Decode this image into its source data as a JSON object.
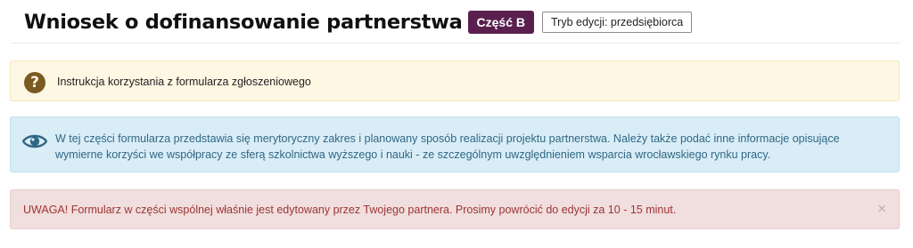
{
  "header": {
    "title": "Wniosek o dofinansowanie partnerstwa",
    "part_badge": "Część B",
    "mode_badge": "Tryb edycji: przedsiębiorca"
  },
  "alerts": {
    "instructions": {
      "icon": "question-circle-icon",
      "text": "Instrukcja korzystania z formularza zgłoszeniowego"
    },
    "info": {
      "icon": "eye-icon",
      "line1": "W tej części formularza przedstawia się merytoryczny zakres i planowany sposób realizacji projektu partnerstwa. Należy także podać inne informacje opisujące",
      "line2": "wymierne korzyści we współpracy ze sferą szkolnictwa wyższego i nauki - ze szczególnym uwzględnieniem wsparcia wrocławskiego rynku pracy."
    },
    "warning": {
      "text": "UWAGA! Formularz w części wspólnej właśnie jest edytowany przez Twojego partnera. Prosimy powrócić do edycji za 10 - 15 minut.",
      "close_label": "×"
    }
  },
  "colors": {
    "badge_bg": "#5a1f4f",
    "instr_bg": "#fdf7e3",
    "info_bg": "#d9edf7",
    "info_text": "#2f6784",
    "warn_bg": "#f1dede",
    "warn_text": "#9c3534"
  }
}
